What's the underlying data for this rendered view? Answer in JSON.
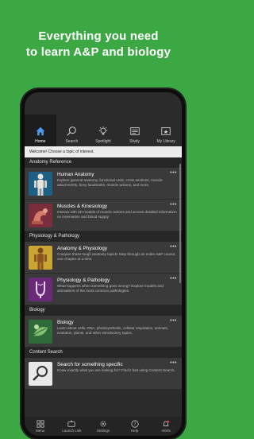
{
  "headline": {
    "line1": "Everything you need",
    "line2": "to learn A&P and biology"
  },
  "tabs": [
    {
      "label": "Home",
      "icon": "home-icon"
    },
    {
      "label": "Search",
      "icon": "search-icon"
    },
    {
      "label": "Spotlight",
      "icon": "lightbulb-icon"
    },
    {
      "label": "Study",
      "icon": "study-icon"
    },
    {
      "label": "My Library",
      "icon": "library-icon"
    }
  ],
  "welcome": "Welcome! Choose a topic of interest.",
  "sections": [
    {
      "title": "Anatomy Reference",
      "items": [
        {
          "title": "Human Anatomy",
          "desc": "Explore general anatomy, functional units, cross sections, muscle attachments, bony landmarks, muscle actions, and more."
        },
        {
          "title": "Muscles & Kinesiology",
          "desc": "Interact with 3D models of muscle actions and access detailed information on innervation and blood supply."
        }
      ]
    },
    {
      "title": "Physiology & Pathology",
      "items": [
        {
          "title": "Anatomy & Physiology",
          "desc": "Conquer those tough anatomy topics! Step through an entire A&P course, one chapter at a time."
        },
        {
          "title": "Physiology & Pathology",
          "desc": "What happens when something goes wrong? Explore models and animations of the most common pathologies."
        }
      ]
    },
    {
      "title": "Biology",
      "items": [
        {
          "title": "Biology",
          "desc": "Learn about cells, DNA, photosynthesis, cellular respiration, animals, evolution, plants, and other introductory topics."
        }
      ]
    },
    {
      "title": "Content Search",
      "items": [
        {
          "title": "Search for something specific",
          "desc": "Know exactly what you are looking for? Find it fast using Content Search."
        }
      ]
    }
  ],
  "dots": "•••",
  "bottom_bar": [
    {
      "label": "Menu",
      "icon": "menu-icon"
    },
    {
      "label": "Launch Link",
      "icon": "link-icon"
    },
    {
      "label": "Settings",
      "icon": "gear-icon"
    },
    {
      "label": "Help",
      "icon": "help-icon"
    },
    {
      "label": "Alerts",
      "icon": "bell-icon"
    }
  ],
  "colors": {
    "background": "#3ca844",
    "active_tab": "#1d1d1d",
    "list_item": "#3a3a3a"
  }
}
